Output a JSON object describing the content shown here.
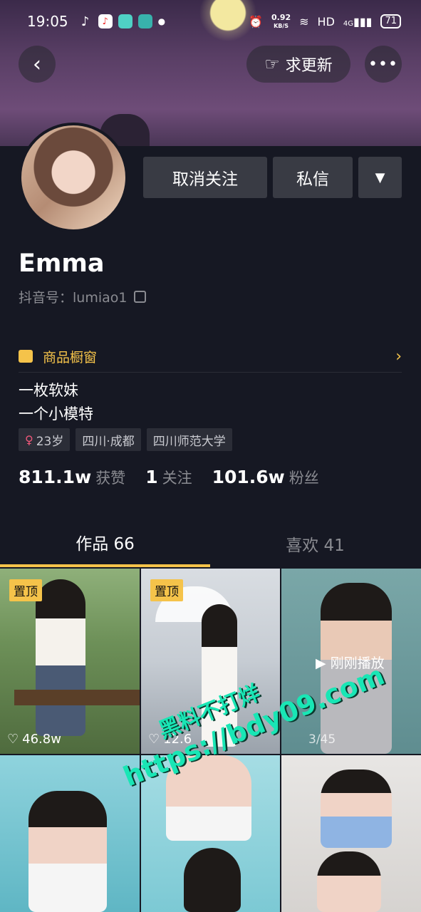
{
  "status_bar": {
    "time": "19:05",
    "net_speed_value": "0.92",
    "net_speed_unit": "KB/S",
    "network_type": "HD",
    "signal": "4G",
    "battery": "71"
  },
  "header": {
    "request_update_label": "求更新",
    "more_label": "•••"
  },
  "actions": {
    "unfollow_label": "取消关注",
    "message_label": "私信"
  },
  "profile": {
    "name": "Emma",
    "douyin_id": "抖音号：lumiao1",
    "shop_window": "商品橱窗",
    "bio_line1": "一枚软妹",
    "bio_line2": "一个小模特",
    "tags": [
      "23岁",
      "四川·成都",
      "四川师范大学"
    ]
  },
  "stats": {
    "likes_value": "811.1w",
    "likes_label": "获赞",
    "following_value": "1",
    "following_label": "关注",
    "followers_value": "101.6w",
    "followers_label": "粉丝"
  },
  "tabs": {
    "works": "作品 66",
    "likes": "喜欢 41"
  },
  "grid": {
    "pinned_label": "置顶",
    "item1_likes": "46.8w",
    "item2_likes": "12.6",
    "item3_status": "刚刚播放",
    "item3_counter": "3/45"
  },
  "watermark": {
    "line1": "黑料不打烊",
    "line2": "https://bdy09.com"
  },
  "colors": {
    "background": "#161823",
    "accent": "#f5c34a",
    "button": "#393b44",
    "watermark": "#19e6b5"
  }
}
